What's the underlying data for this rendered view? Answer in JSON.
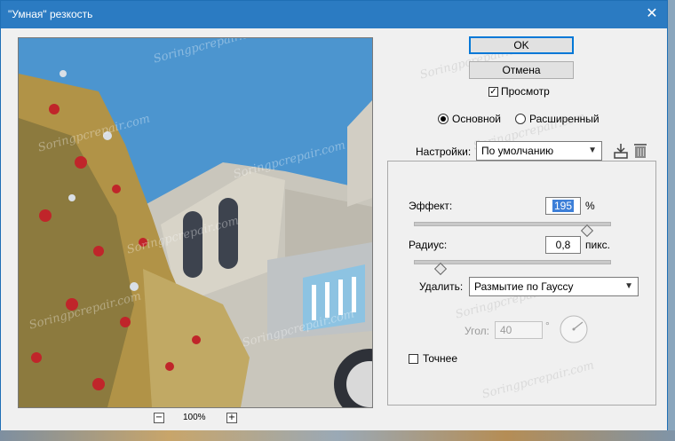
{
  "window": {
    "title": "\"Умная\" резкость",
    "close_glyph": "✕"
  },
  "preview": {
    "zoom_minus": "−",
    "zoom_plus": "+",
    "zoom_level": "100%"
  },
  "buttons": {
    "ok": "OK",
    "cancel": "Отмена"
  },
  "preview_checkbox": {
    "label": "Просмотр",
    "checked": true
  },
  "mode": {
    "basic": "Основной",
    "advanced": "Расширенный",
    "selected": "basic"
  },
  "settings": {
    "label": "Настройки:",
    "value": "По умолчанию"
  },
  "amount": {
    "label": "Эффект:",
    "value": "195",
    "unit": "%",
    "fraction": 0.88
  },
  "radius": {
    "label": "Радиус:",
    "value": "0,8",
    "unit": "пикс.",
    "fraction": 0.13
  },
  "remove": {
    "label": "Удалить:",
    "value": "Размытие по Гауссу"
  },
  "angle": {
    "label": "Угол:",
    "value": "40",
    "unit": "°"
  },
  "more_accurate": {
    "label": "Точнее",
    "checked": false
  },
  "watermark": "Soringpcrepair.com",
  "colors": {
    "titlebar": "#2b7bc2",
    "accent": "#0078d7",
    "selection": "#3d7fd8"
  }
}
